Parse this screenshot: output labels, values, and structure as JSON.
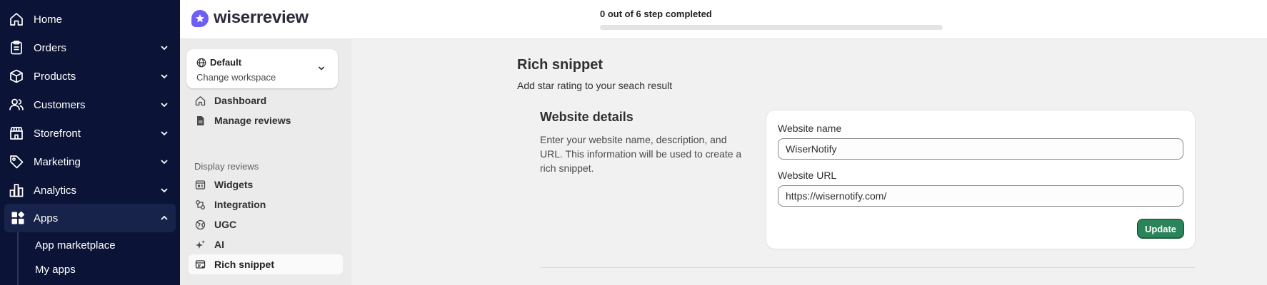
{
  "admin_nav": {
    "items": [
      {
        "label": "Home",
        "icon": "home-icon",
        "has_chevron": false
      },
      {
        "label": "Orders",
        "icon": "orders-icon",
        "has_chevron": true
      },
      {
        "label": "Products",
        "icon": "products-icon",
        "has_chevron": true
      },
      {
        "label": "Customers",
        "icon": "customers-icon",
        "has_chevron": true
      },
      {
        "label": "Storefront",
        "icon": "storefront-icon",
        "has_chevron": true
      },
      {
        "label": "Marketing",
        "icon": "marketing-icon",
        "has_chevron": true
      },
      {
        "label": "Analytics",
        "icon": "analytics-icon",
        "has_chevron": true
      },
      {
        "label": "Apps",
        "icon": "apps-icon",
        "has_chevron": true,
        "expanded": true
      }
    ],
    "sub_items": [
      "App marketplace",
      "My apps"
    ]
  },
  "topbar": {
    "logo_text": "wiserreview",
    "steps_label": "0 out of 6 step completed",
    "steps_progress": 0
  },
  "app_sidebar": {
    "workspace": {
      "name": "Default",
      "subtitle": "Change workspace"
    },
    "items": [
      {
        "label": "Dashboard",
        "icon": "dashboard-icon"
      },
      {
        "label": "Manage reviews",
        "icon": "manage-reviews-icon"
      }
    ],
    "section_label": "Display reviews",
    "section_items": [
      {
        "label": "Widgets",
        "icon": "widgets-icon"
      },
      {
        "label": "Integration",
        "icon": "integration-icon"
      },
      {
        "label": "UGC",
        "icon": "ugc-icon"
      },
      {
        "label": "AI",
        "icon": "ai-sparkle-icon"
      },
      {
        "label": "Rich snippet",
        "icon": "rich-snippet-icon",
        "selected": true
      }
    ]
  },
  "main": {
    "title": "Rich snippet",
    "subtitle": "Add star rating to your seach result",
    "section_title": "Website details",
    "section_desc": "Enter your website name, description, and URL. This information will be used to create a rich snippet.",
    "fields": {
      "name_label": "Website name",
      "name_value": "WiserNotify",
      "url_label": "Website URL",
      "url_value": "https://wisernotify.com/"
    },
    "update_label": "Update"
  },
  "colors": {
    "admin_nav_bg": "#0b1437",
    "brand": "#6d5ef6",
    "primary_button": "#29845a"
  }
}
